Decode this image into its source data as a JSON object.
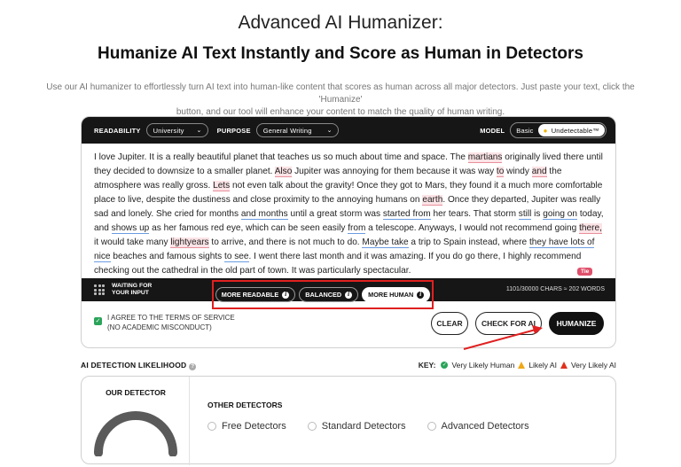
{
  "header": {
    "title": "Advanced AI Humanizer:",
    "subtitle": "Humanize AI Text Instantly and Score as Human in Detectors",
    "description_line1": "Use our AI humanizer to effortlessly turn AI text into human-like content that scores as human across all major detectors. Just paste your text, click the 'Humanize'",
    "description_line2": "button, and our tool will enhance your content to match the quality of human writing."
  },
  "toolbar": {
    "readability_label": "READABILITY",
    "readability_value": "University",
    "purpose_label": "PURPOSE",
    "purpose_value": "General Writing",
    "model_label": "MODEL",
    "model_basic": "Basic",
    "model_undetectable": "Undetectable™"
  },
  "editor": {
    "segments": [
      {
        "t": "I love Jupiter. It is a really beautiful planet that teaches us so much about time and space. The ",
        "s": ""
      },
      {
        "t": "martians",
        "s": "r"
      },
      {
        "t": " originally lived there until they decided to downsize to a smaller planet. ",
        "s": ""
      },
      {
        "t": "Also",
        "s": "r"
      },
      {
        "t": " Jupiter was annoying for them because it was way ",
        "s": ""
      },
      {
        "t": "to",
        "s": "r"
      },
      {
        "t": " windy ",
        "s": ""
      },
      {
        "t": "and",
        "s": "r"
      },
      {
        "t": " the atmosphere was really gross. ",
        "s": ""
      },
      {
        "t": "Lets",
        "s": "r"
      },
      {
        "t": " not even talk about the gravity! Once they got to Mars, they found it a much more comfortable place to live, despite the dustiness and close proximity to the annoying humans on ",
        "s": ""
      },
      {
        "t": "earth",
        "s": "r"
      },
      {
        "t": ". Once they departed, Jupiter was really sad and lonely. She cried for months ",
        "s": ""
      },
      {
        "t": "and months",
        "s": "b"
      },
      {
        "t": " until a great storm was ",
        "s": ""
      },
      {
        "t": "started from",
        "s": "b"
      },
      {
        "t": " her tears. That storm ",
        "s": ""
      },
      {
        "t": "still",
        "s": "b"
      },
      {
        "t": " is ",
        "s": ""
      },
      {
        "t": "going on",
        "s": "b"
      },
      {
        "t": " today, and ",
        "s": ""
      },
      {
        "t": "shows up",
        "s": "b"
      },
      {
        "t": " as her famous red eye, which can be seen easily ",
        "s": ""
      },
      {
        "t": "from",
        "s": "b"
      },
      {
        "t": " a telescope. Anyways, I would not recommend going ",
        "s": ""
      },
      {
        "t": "there,",
        "s": "r"
      },
      {
        "t": " it would take many ",
        "s": ""
      },
      {
        "t": "lightyears",
        "s": "r"
      },
      {
        "t": " to arrive, and there is not much to do. ",
        "s": ""
      },
      {
        "t": "Maybe take",
        "s": "b"
      },
      {
        "t": " a trip to Spain instead, where ",
        "s": ""
      },
      {
        "t": "they have lots of nice",
        "s": "b"
      },
      {
        "t": " beaches and famous sights ",
        "s": ""
      },
      {
        "t": "to see",
        "s": "b"
      },
      {
        "t": ". I went there last month and it was amazing. If you do go there, I highly recommend checking out the cathedral in the old part of town. It was particularly spectacular.",
        "s": ""
      }
    ],
    "tie_badge": "Tie"
  },
  "bottombar": {
    "waiting_line1": "WAITING FOR",
    "waiting_line2": "YOUR INPUT",
    "modes": [
      {
        "label": "MORE READABLE",
        "active": false
      },
      {
        "label": "BALANCED",
        "active": false
      },
      {
        "label": "MORE HUMAN",
        "active": true
      }
    ],
    "chars": "1101/30000 CHARS ≈ 202 WORDS"
  },
  "footer": {
    "agree_line1": "I AGREE TO THE TERMS OF SERVICE",
    "agree_line2": "(NO ACADEMIC MISCONDUCT)",
    "clear": "CLEAR",
    "check": "CHECK FOR AI",
    "humanize": "HUMANIZE"
  },
  "detection": {
    "title": "AI DETECTION LIKELIHOOD",
    "key_label": "KEY:",
    "key_human": "Very Likely Human",
    "key_likely": "Likely AI",
    "key_very": "Very Likely AI",
    "our_detector": "OUR DETECTOR",
    "other_detectors": "OTHER DETECTORS",
    "options": [
      "Free Detectors",
      "Standard Detectors",
      "Advanced Detectors"
    ]
  },
  "colors": {
    "accent_red": "#e02020",
    "human_green": "#2aa45a",
    "likely_orange": "#f0a818",
    "very_likely_red": "#e0301e"
  }
}
